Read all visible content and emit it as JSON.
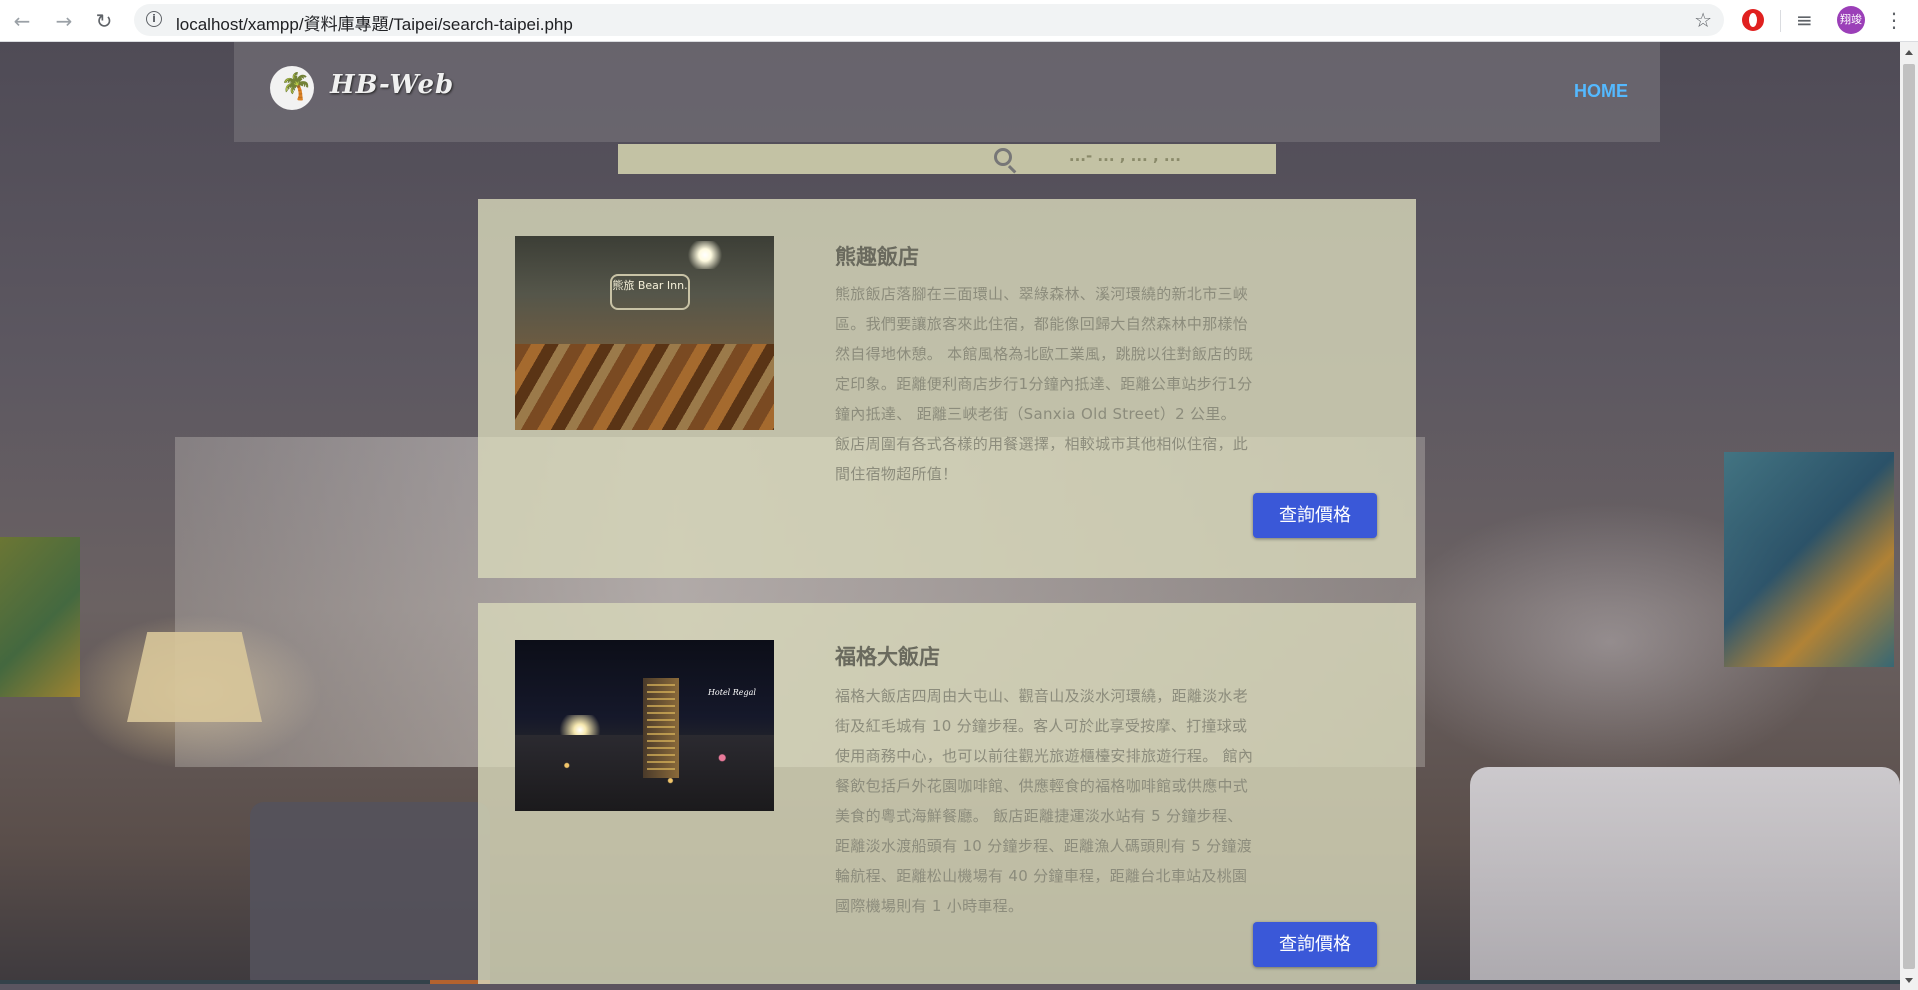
{
  "browser": {
    "url": "localhost/xampp/資料庫專題/Taipei/search-taipei.php",
    "profile_initials": "翔竣"
  },
  "site": {
    "logo_text": "HB-Web",
    "nav_home": "HOME",
    "search_placeholder": "...- ... , ... , ..."
  },
  "hotels": [
    {
      "name": "熊趣飯店",
      "photo_sign": "熊旅 Bear Inn.",
      "description": "熊旅飯店落腳在三面環山、翠綠森林、溪河環繞的新北市三峽區。我們要讓旅客來此住宿，都能像回歸大自然森林中那樣怡然自得地休憩。 本館風格為北歐工業風，跳脫以往對飯店的既定印象。距離便利商店步行1分鐘內抵達、距離公車站步行1分鐘內抵達、 距離三峽老街（Sanxia Old Street）2 公里。 飯店周圍有各式各樣的用餐選擇，相較城市其他相似住宿，此間住宿物超所值！",
      "button_label": "查詢價格"
    },
    {
      "name": "福格大飯店",
      "photo_mark": "Hotel Regal",
      "description": "福格大飯店四周由大屯山、觀音山及淡水河環繞，距離淡水老街及紅毛城有 10 分鐘步程。客人可於此享受按摩、打撞球或使用商務中心，也可以前往觀光旅遊櫃檯安排旅遊行程。 館內餐飲包括戶外花園咖啡館、供應輕食的福格咖啡館或供應中式美食的粵式海鮮餐廳。 飯店距離捷運淡水站有 5 分鐘步程、距離淡水渡船頭有 10 分鐘步程、距離漁人碼頭則有 5 分鐘渡輪航程、距離松山機場有 40 分鐘車程，距離台北車站及桃園國際機場則有 1 小時車程。",
      "button_label": "查詢價格"
    }
  ],
  "colors": {
    "nav_link": "#54b9ff",
    "button_bg": "#3a58d8",
    "card_bg": "#d7d7b9"
  }
}
